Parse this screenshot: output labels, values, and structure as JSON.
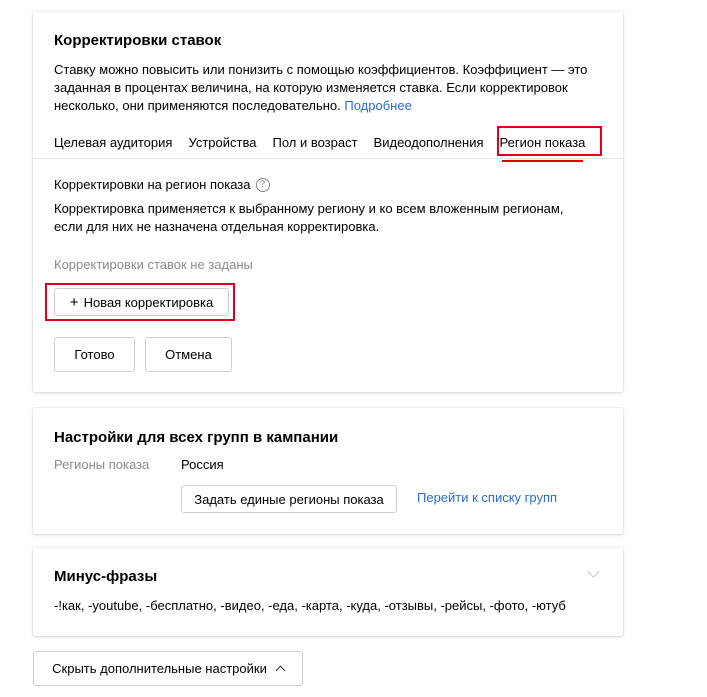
{
  "bid_adjustments": {
    "title": "Корректировки ставок",
    "description_line1": "Ставку можно повысить или понизить с помощью коэффициентов. Коэффициент — это",
    "description_line2": "заданная в процентах величина, на которую изменяется ставка. Если корректировок",
    "description_line3": "несколько, они применяются последовательно.",
    "more_link": "Подробнее",
    "tabs": [
      {
        "label": "Целевая аудитория"
      },
      {
        "label": "Устройства"
      },
      {
        "label": "Пол и возраст"
      },
      {
        "label": "Видеодополнения"
      },
      {
        "label": "Регион показа",
        "active": true
      }
    ],
    "region_section": {
      "title": "Корректировки на регион показа",
      "help_icon": "?",
      "description_line1": "Корректировка применяется к выбранному региону и ко всем вложенным регионам,",
      "description_line2": "если для них не назначена отдельная корректировка.",
      "empty_text": "Корректировки ставок не заданы",
      "new_button_icon": "+",
      "new_button": "Новая корректировка"
    },
    "done_button": "Готово",
    "cancel_button": "Отмена"
  },
  "group_settings": {
    "title": "Настройки для всех групп в кампании",
    "regions_label": "Регионы показа",
    "regions_value": "Россия",
    "set_regions_button": "Задать единые регионы показа",
    "groups_link": "Перейти к списку групп"
  },
  "minus_phrases": {
    "title": "Минус-фразы",
    "phrases": "-!как, -youtube, -бесплатно, -видео, -еда, -карта, -куда, -отзывы, -рейсы, -фото, -ютуб"
  },
  "hide_settings_button": "Скрыть дополнительные настройки",
  "colors": {
    "link": "#2b6bd6",
    "highlight": "#e0001b",
    "active_tab_underline": "#dd0000",
    "muted_text": "#8c8c8c"
  }
}
